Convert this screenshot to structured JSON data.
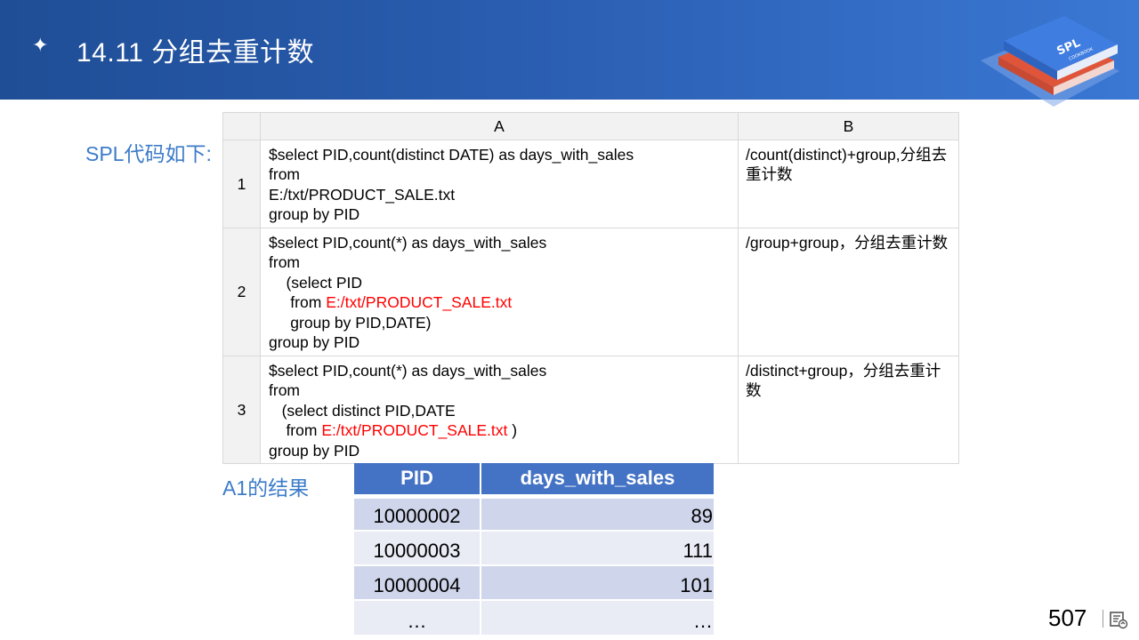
{
  "header": {
    "star_glyph": "✦",
    "title": "14.11 分组去重计数",
    "logo_text": "SPL",
    "logo_subtext": "COOKBOOK"
  },
  "spl_label": "SPL代码如下:",
  "grid": {
    "columns": [
      "A",
      "B"
    ],
    "rows": [
      {
        "num": "1",
        "code": [
          [
            {
              "t": "$select PID,count(distinct DATE) as days_with_sales"
            }
          ],
          [
            {
              "t": "from"
            }
          ],
          [
            {
              "t": "E:/txt/PRODUCT_SALE.txt"
            }
          ],
          [
            {
              "t": "group by PID"
            }
          ]
        ],
        "note": "/count(distinct)+group,分组去重计数"
      },
      {
        "num": "2",
        "code": [
          [
            {
              "t": "$select PID,count(*) as days_with_sales"
            }
          ],
          [
            {
              "t": "from"
            }
          ],
          [
            {
              "t": "    (select PID"
            }
          ],
          [
            {
              "t": "     from "
            },
            {
              "t": "E:/txt/PRODUCT_SALE.txt",
              "red": true
            }
          ],
          [
            {
              "t": "     group by PID,DATE)"
            }
          ],
          [
            {
              "t": "group by PID"
            }
          ]
        ],
        "note": "/group+group，分组去重计数"
      },
      {
        "num": "3",
        "code": [
          [
            {
              "t": "$select PID,count(*) as days_with_sales"
            }
          ],
          [
            {
              "t": "from"
            }
          ],
          [
            {
              "t": "   (select distinct PID,DATE"
            }
          ],
          [
            {
              "t": "    from "
            },
            {
              "t": "E:/txt/PRODUCT_SALE.txt",
              "red": true
            },
            {
              "t": " )"
            }
          ],
          [
            {
              "t": "group by PID"
            }
          ]
        ],
        "note": "/distinct+group，分组去重计数"
      }
    ]
  },
  "a1_label": "A1的结果",
  "result": {
    "headers": [
      "PID",
      "days_with_sales"
    ],
    "rows": [
      [
        "10000002",
        "89"
      ],
      [
        "10000003",
        "111"
      ],
      [
        "10000004",
        "101"
      ],
      [
        "…",
        "…"
      ]
    ]
  },
  "footer": {
    "page_number": "507",
    "nav_icon": "slide-navigation-icon"
  },
  "colors": {
    "header_blue": "#2a5db0",
    "label_blue": "#3d7cc9",
    "table_header_blue": "#4472c4",
    "row_band_dark": "#cfd5ea",
    "row_band_light": "#e9ebf5",
    "code_red": "#ff0000"
  }
}
